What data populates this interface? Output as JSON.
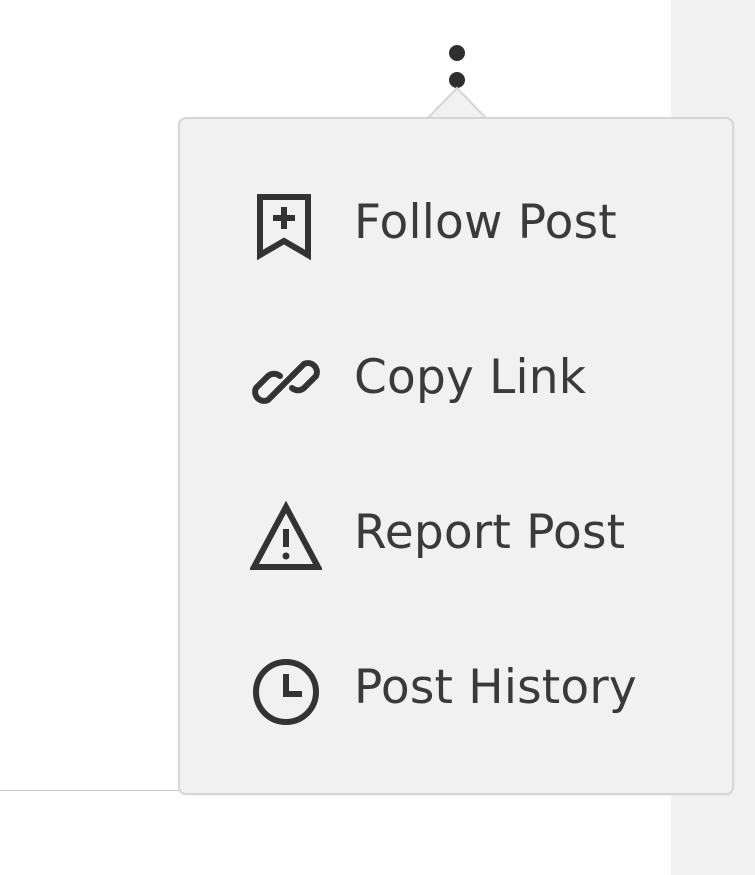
{
  "menu": {
    "items": [
      {
        "id": "follow",
        "label": "Follow Post",
        "icon": "bookmark-plus-icon"
      },
      {
        "id": "copy",
        "label": "Copy Link",
        "icon": "link-icon"
      },
      {
        "id": "report",
        "label": "Report Post",
        "icon": "warning-icon"
      },
      {
        "id": "history",
        "label": "Post History",
        "icon": "clock-icon"
      }
    ]
  },
  "colors": {
    "menu_background": "#f1f1f1",
    "menu_border": "#d6d6d6",
    "text": "#3a3a3a",
    "gutter": "#f1f1f1"
  }
}
